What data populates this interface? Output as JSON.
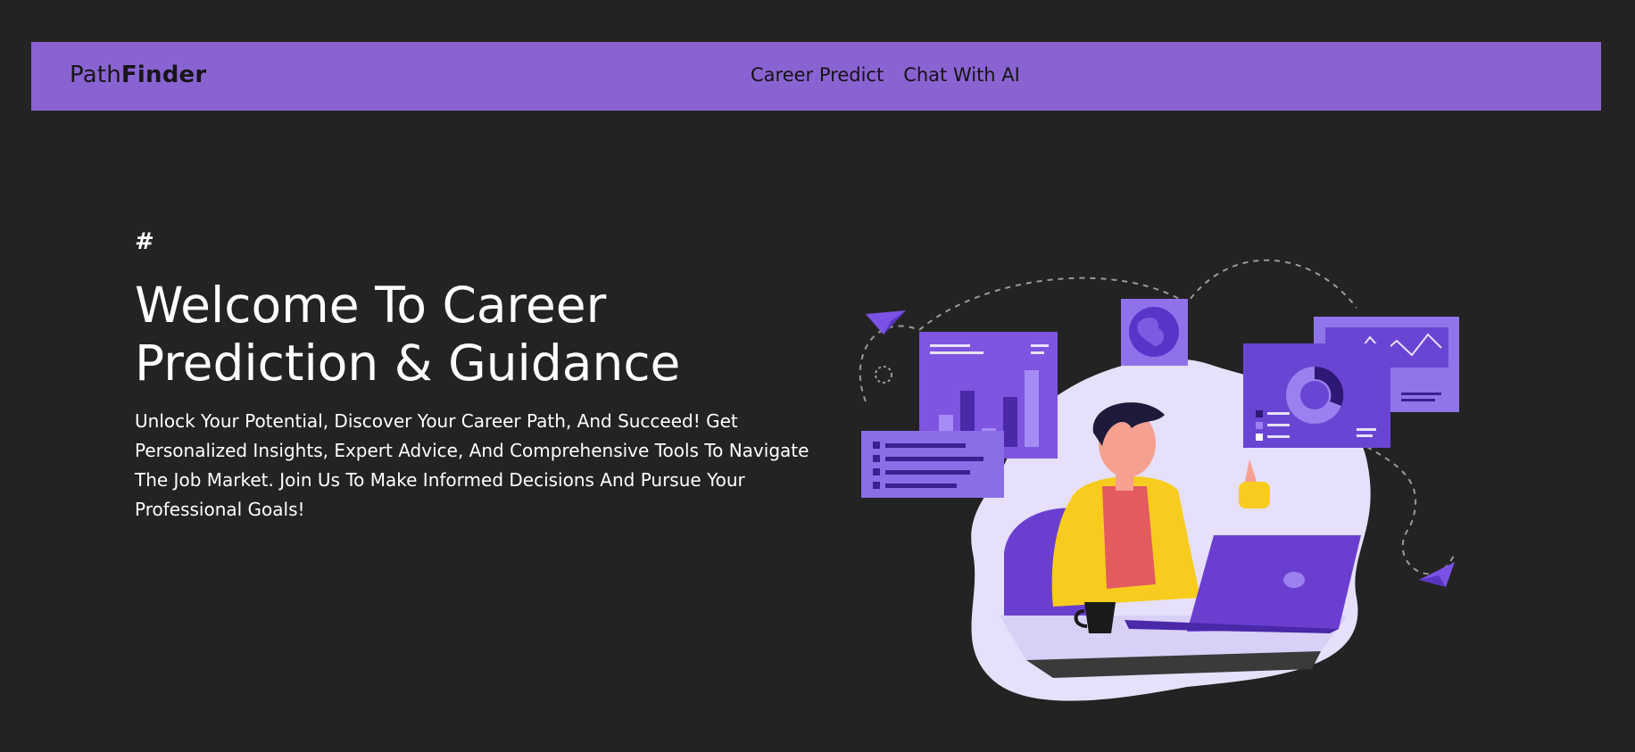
{
  "navbar": {
    "brand_light": "Path",
    "brand_bold": "Finder",
    "links": [
      {
        "label": "Career Predict"
      },
      {
        "label": "Chat With AI"
      }
    ]
  },
  "hero": {
    "marker": "#",
    "title": "Welcome To Career Prediction & Guidance",
    "description": "Unlock Your Potential, Discover Your Career Path, And Succeed! Get Personalized Insights, Expert Advice, And Comprehensive Tools To Navigate The Job Market. Join Us To Make Informed Decisions And Pursue Your Professional Goals!"
  },
  "colors": {
    "background": "#232323",
    "navbar": "#8a63d2",
    "accent_purple": "#6c3fd8",
    "text": "#ffffff"
  },
  "icons": [
    "career-illustration",
    "paper-plane-icon",
    "globe-icon",
    "laptop-icon",
    "coffee-cup-icon"
  ]
}
